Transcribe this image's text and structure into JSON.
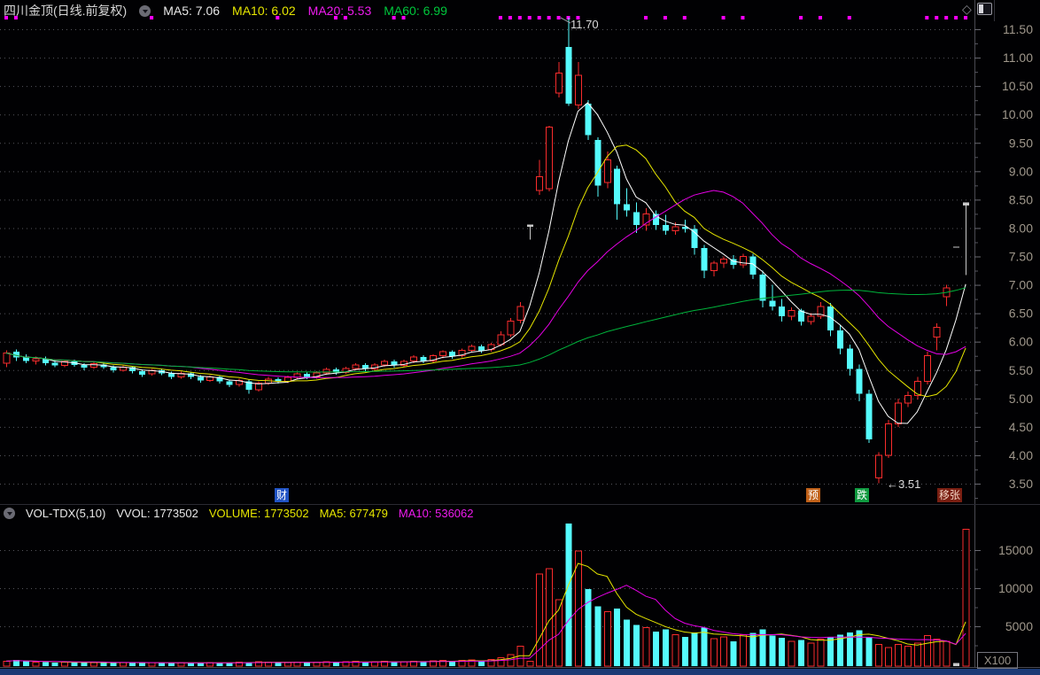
{
  "header": {
    "title": "四川金顶(日线.前复权)",
    "ma5": "MA5: 7.06",
    "ma10": "MA10: 6.02",
    "ma20": "MA20: 5.53",
    "ma60": "MA60: 6.99"
  },
  "volume_header": {
    "indicator": "VOL-TDX(5,10)",
    "vvol": "VVOL: 1773502",
    "volume": "VOLUME: 1773502",
    "ma5": "MA5: 677479",
    "ma10": "MA10: 536062"
  },
  "window_icons": {
    "diamond": "◇"
  },
  "tags": {
    "finance": "财",
    "forecast": "预",
    "fall": "跌",
    "rise": "移张"
  },
  "annotations": {
    "peak": "11.70",
    "trough": "←3.51"
  },
  "axis": {
    "volume_unit": "X100"
  },
  "colors": {
    "up": "#f92c2c",
    "down": "#55fbfd",
    "grey_candle": "#c8c8c8",
    "ma5": "#ffffff",
    "ma10": "#e6e600",
    "ma20": "#e600e6",
    "ma60": "#00b43c",
    "vol_ma5": "#e6e600",
    "vol_ma10": "#e600e6",
    "dots": "#ff00ff",
    "axis_text": "#a0988c",
    "grid": "#55555d",
    "axis_line": "#4a4a52"
  },
  "chart_data": {
    "type": "candlestick",
    "title": "四川金顶(日线.前复权)",
    "price_ticks": [
      11.5,
      11.0,
      10.5,
      10.0,
      9.5,
      9.0,
      8.5,
      8.0,
      7.5,
      7.0,
      6.5,
      6.0,
      5.5,
      5.0,
      4.5,
      4.0,
      3.5
    ],
    "volume_ticks": [
      15000,
      10000,
      5000
    ],
    "ylim": [
      3.3,
      11.9
    ],
    "volume_unit": "X100",
    "peak_value": 11.7,
    "trough_value": 3.51,
    "ma_windows": {
      "price": [
        5,
        10,
        20,
        60
      ],
      "volume": [
        5,
        10
      ]
    },
    "signal_dot_indices": [
      0,
      1,
      15,
      28,
      34,
      35,
      40,
      41,
      51,
      52,
      53,
      54,
      55,
      56,
      57,
      58,
      59,
      66,
      68,
      70,
      74,
      76,
      82,
      84,
      87,
      95,
      96,
      97,
      98,
      99
    ],
    "candles": [
      [
        5.62,
        5.85,
        5.55,
        5.8,
        420,
        0
      ],
      [
        5.82,
        5.86,
        5.66,
        5.72,
        560,
        0
      ],
      [
        5.74,
        5.78,
        5.62,
        5.66,
        380,
        0
      ],
      [
        5.66,
        5.74,
        5.6,
        5.7,
        300,
        0
      ],
      [
        5.7,
        5.74,
        5.58,
        5.62,
        280,
        0
      ],
      [
        5.63,
        5.68,
        5.55,
        5.58,
        260,
        0
      ],
      [
        5.58,
        5.68,
        5.55,
        5.65,
        300,
        0
      ],
      [
        5.65,
        5.68,
        5.56,
        5.59,
        240,
        0
      ],
      [
        5.59,
        5.62,
        5.5,
        5.54,
        230,
        0
      ],
      [
        5.55,
        5.64,
        5.52,
        5.61,
        260,
        0
      ],
      [
        5.6,
        5.63,
        5.52,
        5.55,
        220,
        0
      ],
      [
        5.55,
        5.58,
        5.46,
        5.5,
        210,
        0
      ],
      [
        5.5,
        5.58,
        5.47,
        5.55,
        240,
        0
      ],
      [
        5.55,
        5.57,
        5.44,
        5.48,
        220,
        0
      ],
      [
        5.48,
        5.51,
        5.38,
        5.42,
        210,
        0
      ],
      [
        5.43,
        5.52,
        5.4,
        5.5,
        230,
        0
      ],
      [
        5.5,
        5.53,
        5.41,
        5.44,
        200,
        0
      ],
      [
        5.44,
        5.47,
        5.34,
        5.38,
        210,
        0
      ],
      [
        5.38,
        5.47,
        5.35,
        5.44,
        220,
        0
      ],
      [
        5.44,
        5.46,
        5.34,
        5.38,
        190,
        0
      ],
      [
        5.38,
        5.41,
        5.28,
        5.32,
        200,
        0
      ],
      [
        5.32,
        5.41,
        5.29,
        5.38,
        210,
        0
      ],
      [
        5.38,
        5.4,
        5.26,
        5.3,
        190,
        0
      ],
      [
        5.3,
        5.33,
        5.2,
        5.24,
        200,
        0
      ],
      [
        5.25,
        5.35,
        5.21,
        5.32,
        280,
        0
      ],
      [
        5.3,
        5.33,
        5.08,
        5.15,
        300,
        0
      ],
      [
        5.15,
        5.3,
        5.12,
        5.27,
        320,
        0
      ],
      [
        5.27,
        5.38,
        5.24,
        5.34,
        280,
        0
      ],
      [
        5.34,
        5.37,
        5.26,
        5.3,
        230,
        0
      ],
      [
        5.3,
        5.4,
        5.27,
        5.37,
        260,
        0
      ],
      [
        5.37,
        5.46,
        5.33,
        5.43,
        290,
        0
      ],
      [
        5.43,
        5.46,
        5.34,
        5.38,
        240,
        0
      ],
      [
        5.38,
        5.48,
        5.35,
        5.45,
        300,
        0
      ],
      [
        5.45,
        5.54,
        5.42,
        5.51,
        330,
        0
      ],
      [
        5.51,
        5.54,
        5.42,
        5.46,
        260,
        0
      ],
      [
        5.46,
        5.56,
        5.43,
        5.53,
        350,
        0
      ],
      [
        5.53,
        5.62,
        5.5,
        5.59,
        380,
        0
      ],
      [
        5.59,
        5.62,
        5.48,
        5.52,
        290,
        0
      ],
      [
        5.52,
        5.62,
        5.49,
        5.59,
        330,
        0
      ],
      [
        5.59,
        5.68,
        5.56,
        5.65,
        400,
        0
      ],
      [
        5.65,
        5.68,
        5.54,
        5.58,
        300,
        0
      ],
      [
        5.58,
        5.68,
        5.55,
        5.65,
        350,
        0
      ],
      [
        5.66,
        5.76,
        5.62,
        5.73,
        430,
        0
      ],
      [
        5.73,
        5.76,
        5.62,
        5.66,
        320,
        0
      ],
      [
        5.66,
        5.78,
        5.63,
        5.75,
        460,
        0
      ],
      [
        5.75,
        5.85,
        5.71,
        5.82,
        500,
        0
      ],
      [
        5.82,
        5.85,
        5.7,
        5.74,
        350,
        0
      ],
      [
        5.75,
        5.88,
        5.72,
        5.85,
        520,
        0
      ],
      [
        5.85,
        5.95,
        5.81,
        5.92,
        580,
        0
      ],
      [
        5.92,
        5.95,
        5.8,
        5.84,
        400,
        0
      ],
      [
        5.86,
        5.98,
        5.82,
        5.95,
        650,
        0
      ],
      [
        5.95,
        6.18,
        5.92,
        6.12,
        900,
        0
      ],
      [
        6.12,
        6.42,
        6.08,
        6.36,
        1300,
        0
      ],
      [
        6.38,
        6.7,
        6.32,
        6.62,
        2400,
        0
      ],
      [
        8.02,
        8.06,
        7.8,
        8.06,
        400,
        1
      ],
      [
        8.66,
        9.2,
        8.58,
        8.9,
        11860,
        0
      ],
      [
        8.69,
        9.8,
        8.65,
        9.78,
        12560,
        0
      ],
      [
        10.38,
        10.92,
        10.3,
        10.73,
        8490,
        0
      ],
      [
        11.19,
        11.7,
        10.15,
        10.19,
        18490,
        0
      ],
      [
        10.17,
        10.92,
        10.1,
        10.69,
        14880,
        0
      ],
      [
        10.19,
        10.25,
        9.55,
        9.64,
        9880,
        0
      ],
      [
        9.55,
        9.6,
        8.55,
        8.75,
        7600,
        0
      ],
      [
        8.8,
        9.35,
        8.7,
        9.2,
        6900,
        0
      ],
      [
        9.04,
        9.1,
        8.15,
        8.42,
        7300,
        0
      ],
      [
        8.42,
        8.7,
        8.2,
        8.31,
        5900,
        0
      ],
      [
        8.28,
        8.45,
        7.91,
        8.05,
        5200,
        0
      ],
      [
        8.05,
        8.35,
        7.95,
        8.25,
        4800,
        0
      ],
      [
        8.25,
        8.31,
        7.97,
        8.05,
        4300,
        0
      ],
      [
        8.05,
        8.23,
        7.88,
        7.95,
        4600,
        0
      ],
      [
        7.95,
        8.1,
        7.88,
        8.02,
        3900,
        0
      ],
      [
        8.02,
        8.15,
        7.92,
        7.98,
        3600,
        0
      ],
      [
        7.98,
        8.05,
        7.53,
        7.65,
        4200,
        0
      ],
      [
        7.65,
        7.7,
        7.12,
        7.25,
        4800,
        0
      ],
      [
        7.25,
        7.42,
        7.15,
        7.38,
        3400,
        0
      ],
      [
        7.38,
        7.5,
        7.3,
        7.45,
        3600,
        0
      ],
      [
        7.45,
        7.52,
        7.28,
        7.35,
        3000,
        0
      ],
      [
        7.35,
        7.55,
        7.3,
        7.5,
        3900,
        0
      ],
      [
        7.5,
        7.55,
        7.1,
        7.18,
        4100,
        0
      ],
      [
        7.18,
        7.25,
        6.6,
        6.72,
        4600,
        0
      ],
      [
        6.72,
        7.0,
        6.55,
        6.62,
        3800,
        0
      ],
      [
        6.62,
        6.75,
        6.35,
        6.45,
        3500,
        0
      ],
      [
        6.45,
        6.6,
        6.38,
        6.55,
        3000,
        0
      ],
      [
        6.55,
        6.58,
        6.28,
        6.35,
        3200,
        0
      ],
      [
        6.35,
        6.5,
        6.3,
        6.45,
        2800,
        0
      ],
      [
        6.45,
        6.7,
        6.4,
        6.62,
        3300,
        0
      ],
      [
        6.62,
        6.68,
        6.1,
        6.2,
        3600,
        0
      ],
      [
        6.2,
        6.28,
        5.78,
        5.88,
        3900,
        0
      ],
      [
        5.88,
        5.95,
        5.4,
        5.52,
        4200,
        0
      ],
      [
        5.52,
        5.6,
        4.95,
        5.08,
        4500,
        0
      ],
      [
        5.08,
        5.15,
        4.22,
        4.28,
        3600,
        0
      ],
      [
        3.6,
        4.05,
        3.51,
        4.0,
        2600,
        0
      ],
      [
        4.0,
        4.62,
        3.95,
        4.55,
        2200,
        0
      ],
      [
        4.55,
        5.0,
        4.5,
        4.92,
        2600,
        0
      ],
      [
        4.92,
        5.12,
        4.85,
        5.05,
        2400,
        0
      ],
      [
        5.05,
        5.38,
        4.98,
        5.3,
        2800,
        0
      ],
      [
        5.3,
        5.82,
        5.25,
        5.75,
        3800,
        0
      ],
      [
        6.08,
        6.32,
        5.85,
        6.25,
        3300,
        0
      ],
      [
        6.79,
        7.0,
        6.63,
        6.95,
        3000,
        0
      ],
      [
        7.67,
        7.67,
        7.67,
        7.67,
        150,
        1
      ],
      [
        8.4,
        8.45,
        7.17,
        8.45,
        17735,
        1
      ]
    ]
  }
}
